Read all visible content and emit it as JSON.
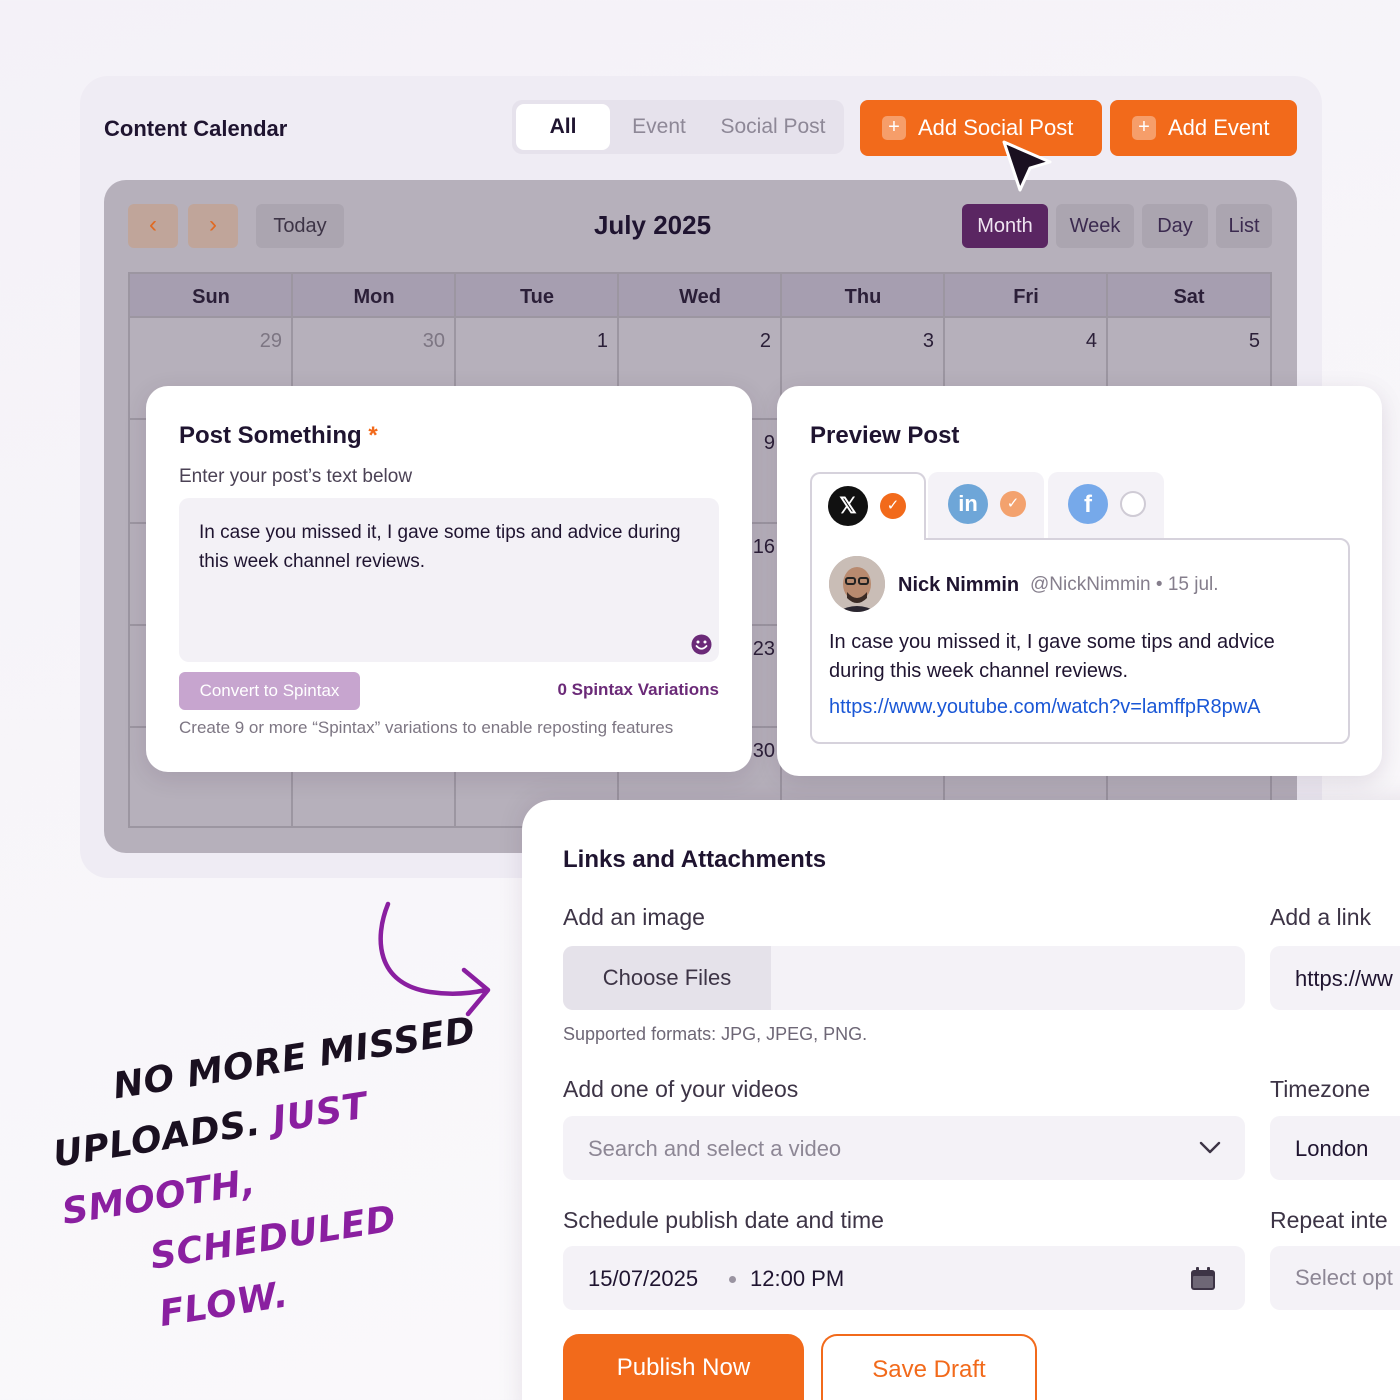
{
  "header": {
    "title": "Content Calendar",
    "filters": [
      "All",
      "Event",
      "Social Post"
    ],
    "active_filter": "All",
    "add_social_post": "Add Social Post",
    "add_event": "Add Event"
  },
  "calendar": {
    "today": "Today",
    "month_title": "July 2025",
    "views": [
      "Month",
      "Week",
      "Day",
      "List"
    ],
    "active_view": "Month",
    "weekdays": [
      "Sun",
      "Mon",
      "Tue",
      "Wed",
      "Thu",
      "Fri",
      "Sat"
    ],
    "first_week": [
      "29",
      "30",
      "1",
      "2",
      "3",
      "4",
      "5"
    ],
    "visible_wed_dates": [
      "9",
      "16",
      "23",
      "30"
    ]
  },
  "post_something": {
    "title": "Post Something",
    "required_mark": "*",
    "subtitle": "Enter your post’s text below",
    "text": "In case you missed it, I gave some tips and advice during this week channel reviews.",
    "convert_button": "Convert to Spintax",
    "variations": "0 Spintax Variations",
    "help": "Create 9 or more “Spintax” variations to enable reposting features"
  },
  "preview": {
    "title": "Preview Post",
    "networks": [
      {
        "icon": "x-logo-icon",
        "glyph": "𝕏",
        "selected": true
      },
      {
        "icon": "linkedin-icon",
        "glyph": "in",
        "selected": true
      },
      {
        "icon": "facebook-icon",
        "glyph": "f",
        "selected": false
      }
    ],
    "author_name": "Nick Nimmin",
    "author_meta": "@NickNimmin • 15 jul.",
    "text": "In case you missed it, I gave some tips and advice during this week channel reviews.",
    "link": "https://www.youtube.com/watch?v=lamffpR8pwA"
  },
  "attachments": {
    "title": "Links and Attachments",
    "image_label": "Add an image",
    "choose_files": "Choose Files",
    "formats": "Supported formats: JPG, JPEG, PNG.",
    "link_label": "Add a link",
    "link_value": "https://ww",
    "video_label": "Add one of your videos",
    "video_placeholder": "Search and select a video",
    "timezone_label": "Timezone",
    "timezone_value": "London",
    "schedule_label": "Schedule publish date and time",
    "date_value": "15/07/2025",
    "time_value": "12:00 PM",
    "repeat_label": "Repeat inte",
    "repeat_placeholder": "Select opt",
    "publish_button": "Publish Now",
    "draft_button": "Save Draft"
  },
  "tagline": {
    "line1": "NO MORE MISSED",
    "line2a": "UPLOADS.",
    "line2b": "JUST SMOOTH,",
    "line3": "SCHEDULED FLOW."
  },
  "colors": {
    "accent": "#f26a1b",
    "purple": "#5a2662",
    "link": "#1a57d6"
  }
}
